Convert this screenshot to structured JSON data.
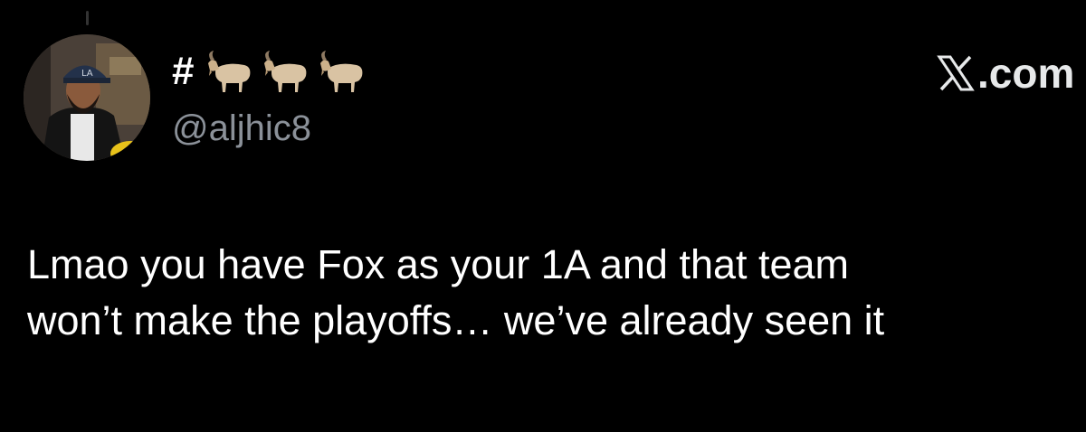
{
  "author": {
    "name_prefix": "#",
    "name_emoji": [
      "goat",
      "goat",
      "goat"
    ],
    "handle": "@aljhic8",
    "avatar_icon": "profile-photo"
  },
  "site": {
    "logo_text": ".com",
    "logo_icon": "x-logo-icon"
  },
  "tweet": {
    "lines": [
      "Lmao you have Fox as your 1A and that team",
      "won’t make the playoffs… we’ve already seen it"
    ]
  },
  "colors": {
    "background": "#000000",
    "text": "#ffffff",
    "handle": "#8b9199"
  }
}
